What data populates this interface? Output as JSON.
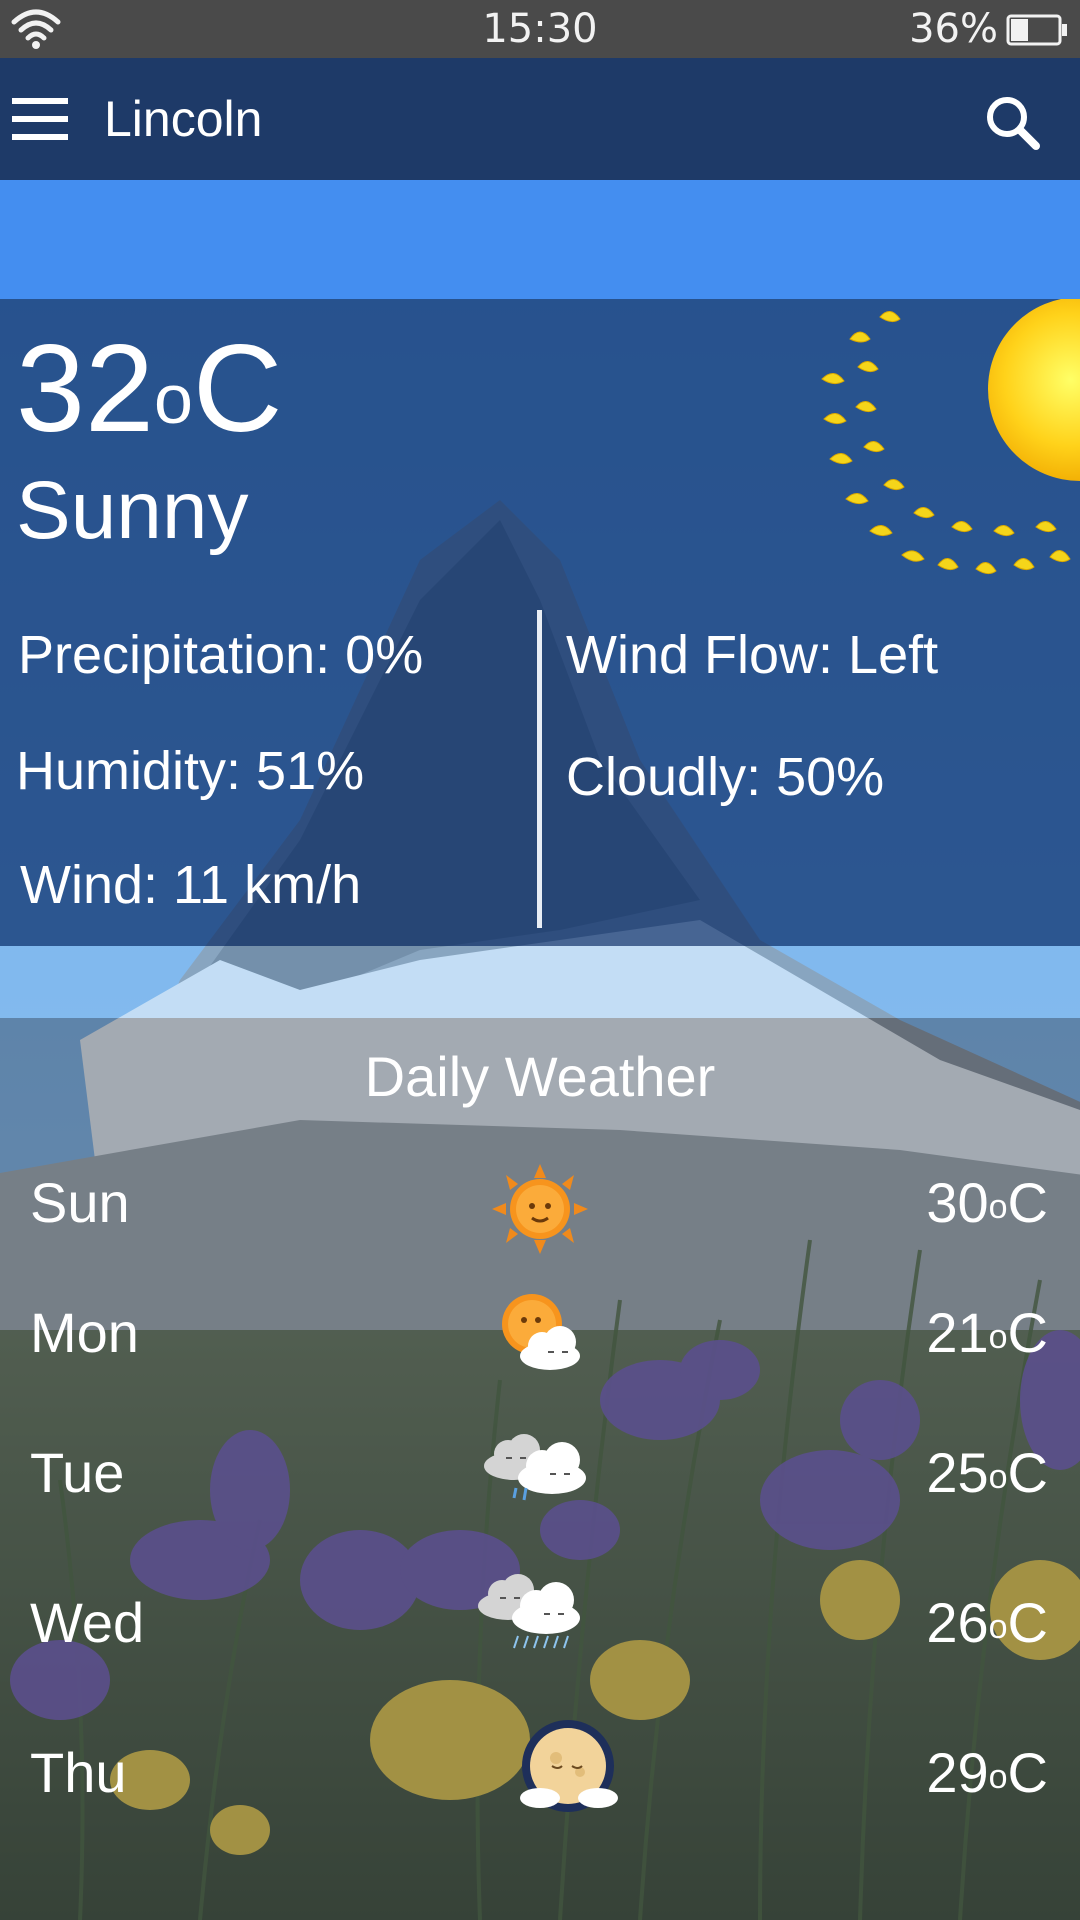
{
  "status_bar": {
    "time": "15:30",
    "battery_percent": "36%",
    "battery_level": 0.36,
    "icons": [
      "wifi-icon",
      "battery-icon"
    ]
  },
  "app_bar": {
    "title": "Lincoln",
    "icons": [
      "menu-icon",
      "search-icon"
    ],
    "color": "#1e3a68"
  },
  "banner": {
    "color": "#448ef0"
  },
  "current": {
    "temperature": "32",
    "unit": "C",
    "condition": "Sunny",
    "icon": "sun-icon",
    "precipitation": "Precipitation: 0%",
    "humidity": "Humidity: 51%",
    "wind": "Wind: 11 km/h",
    "wind_flow": "Wind Flow: Left",
    "cloudy": "Cloudly: 50%"
  },
  "daily": {
    "title": "Daily Weather",
    "days": [
      {
        "name": "Sun",
        "temp": "30",
        "unit": "C",
        "icon": "sunny-icon"
      },
      {
        "name": "Mon",
        "temp": "21",
        "unit": "C",
        "icon": "partly-cloudy-icon"
      },
      {
        "name": "Tue",
        "temp": "25",
        "unit": "C",
        "icon": "rain-clouds-icon"
      },
      {
        "name": "Wed",
        "temp": "26",
        "unit": "C",
        "icon": "rain-clouds-icon"
      },
      {
        "name": "Thu",
        "temp": "29",
        "unit": "C",
        "icon": "moon-cloudy-icon"
      }
    ]
  }
}
